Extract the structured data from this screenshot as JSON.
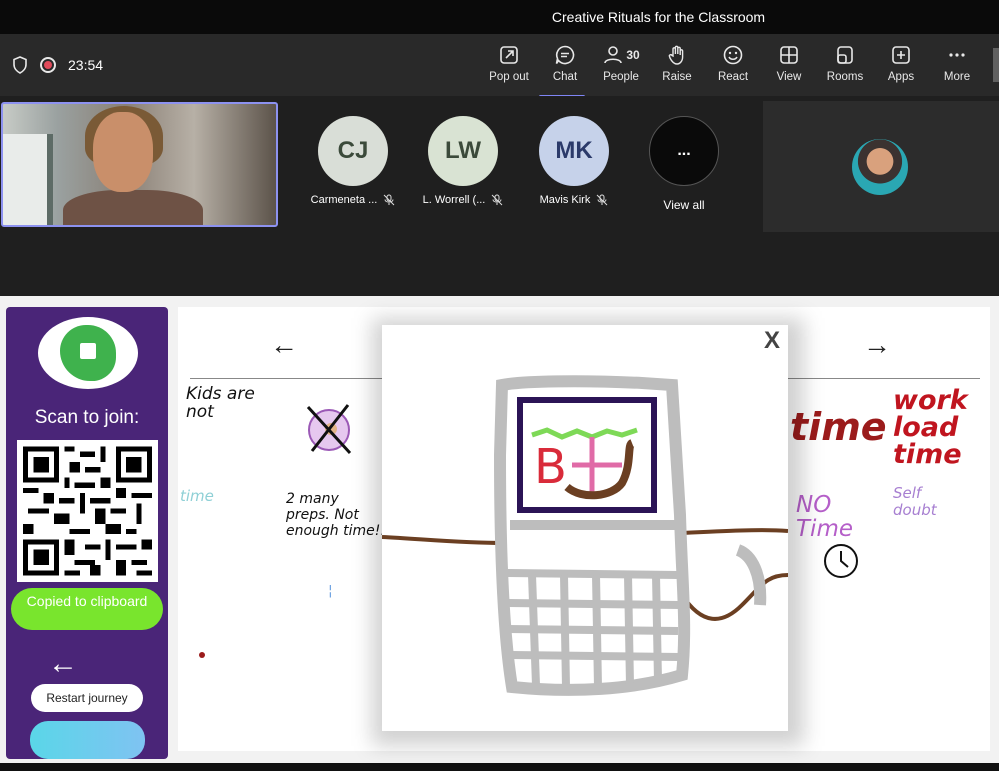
{
  "window": {
    "title": "Creative Rituals for the Classroom"
  },
  "toolbar": {
    "timer": "23:54",
    "buttons": [
      {
        "label": "Pop out",
        "icon": "pop-out-icon"
      },
      {
        "label": "Chat",
        "icon": "chat-icon",
        "active": true
      },
      {
        "label": "People",
        "icon": "people-icon",
        "count": "30"
      },
      {
        "label": "Raise",
        "icon": "raise-hand-icon"
      },
      {
        "label": "React",
        "icon": "react-icon"
      },
      {
        "label": "View",
        "icon": "view-icon"
      },
      {
        "label": "Rooms",
        "icon": "rooms-icon"
      },
      {
        "label": "Apps",
        "icon": "apps-icon"
      },
      {
        "label": "More",
        "icon": "more-icon"
      }
    ]
  },
  "participants": [
    {
      "initials": "CJ",
      "name": "Carmeneta ...",
      "bg": "#d9ded7",
      "fg": "#3b4a3a"
    },
    {
      "initials": "LW",
      "name": "L. Worrell (...",
      "bg": "#d9e3d3",
      "fg": "#3b4a3a"
    },
    {
      "initials": "MK",
      "name": "Mavis Kirk",
      "bg": "#c6d2ea",
      "fg": "#2b3a6a"
    }
  ],
  "view_all": {
    "label": "View all",
    "glyph": "..."
  },
  "side_panel": {
    "scan_label": "Scan to join:",
    "copied_label": "Copied to clipboard",
    "back_glyph": "←",
    "restart_label": "Restart journey"
  },
  "whiteboard": {
    "nav_left": "←",
    "nav_right": "→",
    "notes": {
      "kids_not": "Kids are not",
      "time_left": "time",
      "many_preps": "2 many preps. Not enough time!!",
      "time_red": "time",
      "work_load": "work load time",
      "no_time": "NO Time",
      "self_doubt": "Self doubt"
    },
    "modal_close": "X"
  }
}
